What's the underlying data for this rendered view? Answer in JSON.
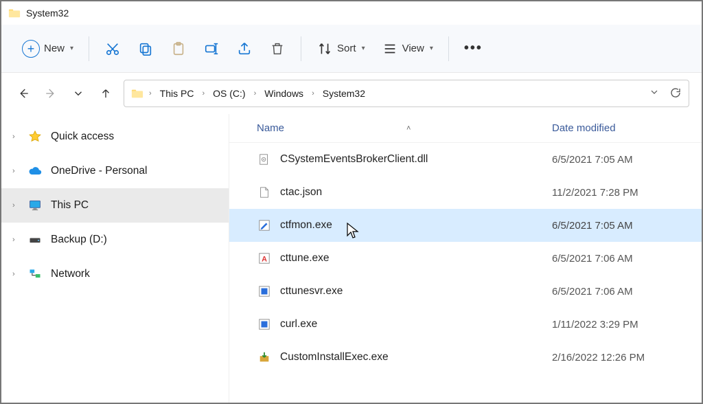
{
  "window": {
    "title": "System32"
  },
  "toolbar": {
    "new_label": "New",
    "sort_label": "Sort",
    "view_label": "View"
  },
  "breadcrumbs": {
    "items": [
      "This PC",
      "OS (C:)",
      "Windows",
      "System32"
    ]
  },
  "sidebar": {
    "items": [
      {
        "label": "Quick access",
        "icon": "star",
        "selected": false
      },
      {
        "label": "OneDrive - Personal",
        "icon": "cloud",
        "selected": false
      },
      {
        "label": "This PC",
        "icon": "monitor",
        "selected": true
      },
      {
        "label": "Backup (D:)",
        "icon": "drive",
        "selected": false
      },
      {
        "label": "Network",
        "icon": "network",
        "selected": false
      }
    ]
  },
  "columns": {
    "name": "Name",
    "date": "Date modified"
  },
  "files": [
    {
      "name": "CSystemEventsBrokerClient.dll",
      "date": "6/5/2021 7:05 AM",
      "icon": "dll",
      "selected": false
    },
    {
      "name": "ctac.json",
      "date": "11/2/2021 7:28 PM",
      "icon": "file",
      "selected": false
    },
    {
      "name": "ctfmon.exe",
      "date": "6/5/2021 7:05 AM",
      "icon": "exe-pen",
      "selected": true
    },
    {
      "name": "cttune.exe",
      "date": "6/5/2021 7:06 AM",
      "icon": "exe-a",
      "selected": false
    },
    {
      "name": "cttunesvr.exe",
      "date": "6/5/2021 7:06 AM",
      "icon": "exe-blue",
      "selected": false
    },
    {
      "name": "curl.exe",
      "date": "1/11/2022 3:29 PM",
      "icon": "exe-blue",
      "selected": false
    },
    {
      "name": "CustomInstallExec.exe",
      "date": "2/16/2022 12:26 PM",
      "icon": "installer",
      "selected": false
    }
  ]
}
